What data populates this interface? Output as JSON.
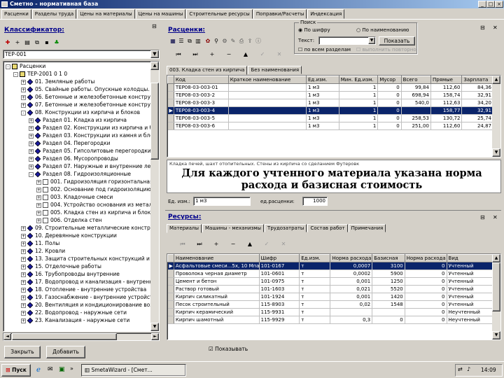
{
  "window": {
    "title": "Сметно - нормативная база",
    "min": "_",
    "max": "□",
    "close": "×"
  },
  "tabs": [
    "Расценки",
    "Разделы труда",
    "Цены на материалы",
    "Цены на машины",
    "Строительные ресурсы",
    "Поправки/Расчеты",
    "Индексация"
  ],
  "classifier": {
    "title": "Классификатор:",
    "combo": "ТЕР-001",
    "tree": [
      {
        "label": "Расценки",
        "level": 0,
        "icon": "folder",
        "exp": "-"
      },
      {
        "label": "ТЕР-2001 0 1 0",
        "level": 1,
        "icon": "folder",
        "exp": "-"
      },
      {
        "label": "01. Земляные работы",
        "level": 2,
        "icon": "diamond",
        "exp": "+"
      },
      {
        "label": "05. Свайные работы. Опускные колодцы. Зак",
        "level": 2,
        "icon": "diamond",
        "exp": "+"
      },
      {
        "label": "06. Бетонные и железобетонные конструкци",
        "level": 2,
        "icon": "diamond",
        "exp": "+"
      },
      {
        "label": "07. Бетонные и железобетонные конструкци",
        "level": 2,
        "icon": "diamond",
        "exp": "+"
      },
      {
        "label": "08. Конструкции из кирпича и блоков",
        "level": 2,
        "icon": "diamond",
        "exp": "-"
      },
      {
        "label": "Раздел 01. Кладка из кирпича",
        "level": 3,
        "icon": "diamond",
        "exp": "+"
      },
      {
        "label": "Раздел 02. Конструкции из кирпича и бло",
        "level": 3,
        "icon": "diamond",
        "exp": "+"
      },
      {
        "label": "Раздел 03. Конструкции из камня и блоков",
        "level": 3,
        "icon": "diamond",
        "exp": "+"
      },
      {
        "label": "Раздел 04. Перегородки",
        "level": 3,
        "icon": "diamond",
        "exp": "+"
      },
      {
        "label": "Раздел 05. Гипсолитовые перегородки",
        "level": 3,
        "icon": "diamond",
        "exp": "+"
      },
      {
        "label": "Раздел 06. Мусоропроводы",
        "level": 3,
        "icon": "diamond",
        "exp": "+"
      },
      {
        "label": "Раздел 07. Наружные и внутренние лест",
        "level": 3,
        "icon": "diamond",
        "exp": "+"
      },
      {
        "label": "Раздел 08. Гидроизоляционные",
        "level": 3,
        "icon": "diamond",
        "exp": "-"
      },
      {
        "label": "001. Гидроизоляция горизонтальная",
        "level": 4,
        "icon": "doc",
        "exp": "+"
      },
      {
        "label": "002. Основание под гидроизоляцию",
        "level": 4,
        "icon": "doc",
        "exp": "+"
      },
      {
        "label": "003. Кладочные смеси",
        "level": 4,
        "icon": "doc",
        "exp": "+"
      },
      {
        "label": "004. Устройство основания из металлическ",
        "level": 4,
        "icon": "doc",
        "exp": "+"
      },
      {
        "label": "005. Кладка стен из кирпича и блоков",
        "level": 4,
        "icon": "doc",
        "exp": "+"
      },
      {
        "label": "006. Отделка стен",
        "level": 4,
        "icon": "doc",
        "exp": "+"
      },
      {
        "label": "09. Строительные металлические конструкции",
        "level": 2,
        "icon": "diamond",
        "exp": "+"
      },
      {
        "label": "10. Деревянные конструкции",
        "level": 2,
        "icon": "diamond",
        "exp": "+"
      },
      {
        "label": "11. Полы",
        "level": 2,
        "icon": "diamond",
        "exp": "+"
      },
      {
        "label": "12. Кровли",
        "level": 2,
        "icon": "diamond",
        "exp": "+"
      },
      {
        "label": "13. Защита строительных конструкций и обо",
        "level": 2,
        "icon": "diamond",
        "exp": "+"
      },
      {
        "label": "15. Отделочные работы",
        "level": 2,
        "icon": "diamond",
        "exp": "+"
      },
      {
        "label": "16. Трубопроводы внутренние",
        "level": 2,
        "icon": "diamond",
        "exp": "+"
      },
      {
        "label": "17. Водопровод и канализация - внутренние",
        "level": 2,
        "icon": "diamond",
        "exp": "+"
      },
      {
        "label": "18. Отопление - внутренние устройства",
        "level": 2,
        "icon": "diamond",
        "exp": "+"
      },
      {
        "label": "19. Газоснабжение - внутренние устройства",
        "level": 2,
        "icon": "diamond",
        "exp": "+"
      },
      {
        "label": "20. Вентиляция и кондиционирование воздух",
        "level": 2,
        "icon": "diamond",
        "exp": "+"
      },
      {
        "label": "22. Водопровод - наружные сети",
        "level": 2,
        "icon": "diamond",
        "exp": "+"
      },
      {
        "label": "23. Канализация - наружные сети",
        "level": 2,
        "icon": "diamond",
        "exp": "+"
      }
    ]
  },
  "rates": {
    "title": "Расценки:",
    "subtabs": [
      "003. Кладка стен из кирпича",
      "Без наименования"
    ],
    "columns": [
      "Код",
      "Краткое наименование",
      "Ед.изм.",
      "Мин. Ед.изм.",
      "Мусор",
      "Всего",
      "Прямые",
      "Зарплата",
      "Машины"
    ],
    "rows": [
      [
        "ТЕР08-03-003-01",
        "",
        "1 м3",
        "1",
        "0",
        "99,84",
        "112,60",
        "84,36"
      ],
      [
        "ТЕР08-03-003-2",
        "",
        "1 м3",
        "1",
        "0",
        "698,94",
        "158,74",
        "32,91"
      ],
      [
        "ТЕР08-03-003-3",
        "",
        "1 м3",
        "1",
        "0",
        "540,0",
        "112,63",
        "34,20"
      ],
      [
        "ТЕР08-03-003-4",
        "",
        "1 м3",
        "1",
        "0",
        "",
        "158,77",
        "32,91"
      ],
      [
        "ТЕР08-03-003-5",
        "",
        "1 м3",
        "1",
        "0",
        "258,53",
        "130,72",
        "25,74"
      ],
      [
        "ТЕР08-03-003-6",
        "",
        "1 м3",
        "1",
        "0",
        "251,00",
        "112,60",
        "24,87"
      ]
    ],
    "selected_row": 3,
    "description": "Кладка печей, шахт отопительных. Стены из кирпича со сделанием Футеровк",
    "annotation": "Для каждого учтенного материала указана норма расхода и базисная стоимость",
    "unit_label": "Ед. изм.:",
    "unit_value": "1 м3",
    "count_label": "ед.расценки:",
    "count_value": "1000"
  },
  "search": {
    "group_title": "Поиск",
    "radio1": "По шифру",
    "radio2": "По наименованию",
    "text_label": "Текст:",
    "button": "Показать",
    "check1": "по всем разделам",
    "check2": "выполнить повторно"
  },
  "resources": {
    "title": "Ресурсы:",
    "tabs": [
      "Материалы",
      "Машины - механизмы",
      "Трудозатраты",
      "Состав работ",
      "Примечания"
    ],
    "columns": [
      "Наименование",
      "Шифр",
      "Ед.изм.",
      "Норма расхода",
      "Базисная",
      "Норма расхода",
      "Вид"
    ],
    "rows": [
      [
        "Асфальтовые смеси...5х, 10 Мпа",
        "101-0167",
        "т",
        "0,0007",
        "3100",
        "0",
        "Учтенный"
      ],
      [
        "Проволока черная диаметр",
        "101-0601",
        "т",
        "0,0002",
        "5900",
        "0",
        "Учтенный"
      ],
      [
        "Цемент и бетон",
        "101-0975",
        "т",
        "0,001",
        "1250",
        "0",
        "Учтенный"
      ],
      [
        "Раствор готовый",
        "101-1603",
        "т",
        "0,021",
        "5520",
        "0",
        "Учтенный"
      ],
      [
        "Кирпич силикатный",
        "101-1924",
        "т",
        "0,001",
        "1420",
        "0",
        "Учтенный"
      ],
      [
        "Песок строительный",
        "115-8903",
        "т",
        "0,02",
        "1548",
        "0",
        "Учтенный"
      ],
      [
        "Кирпич керамический",
        "115-9931",
        "т",
        "",
        "",
        "0",
        "Неучтенный"
      ],
      [
        "Кирпич шамотный",
        "115-9929",
        "т",
        "0,3",
        "0",
        "0",
        "Неучтенный"
      ]
    ],
    "selected_row": 0
  },
  "bottom": {
    "close_btn": "Закрыть",
    "add_btn": "Добавить",
    "checkbox": "Показывать"
  },
  "taskbar": {
    "start": "Пуск",
    "task": "SmetaWizard - [Смет...",
    "clock": "14:09"
  }
}
